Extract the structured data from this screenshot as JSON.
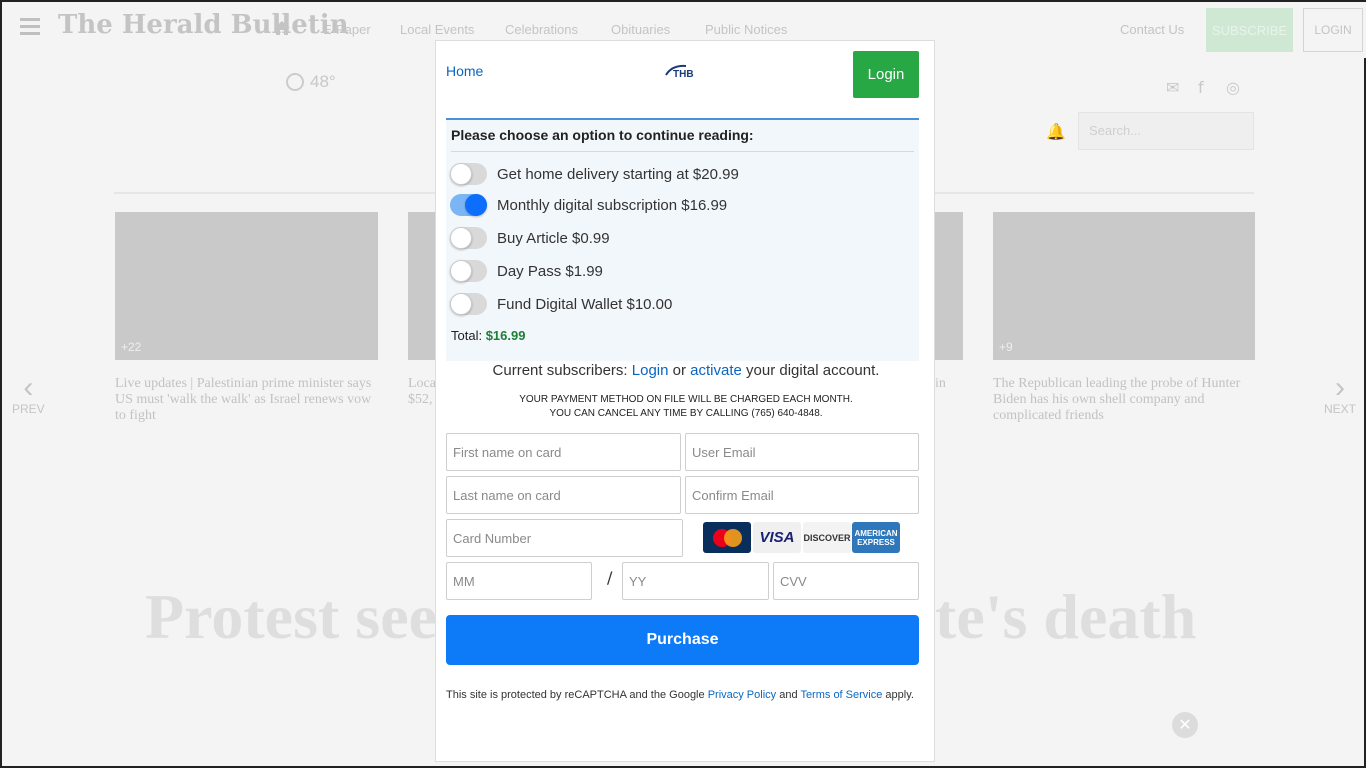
{
  "background": {
    "logo": "The Herald Bulletin",
    "nav": [
      "E-Paper",
      "Local Events",
      "Celebrations",
      "Obituaries",
      "Public Notices"
    ],
    "contact": "Contact Us",
    "subscribe": "SUBSCRIBE",
    "login": "LOGIN",
    "weather": "48°",
    "search_placeholder": "Search...",
    "cards": [
      {
        "count": "+22",
        "caption": "Live updates | Palestinian prime minister says US must 'walk the walk' as Israel renews vow to fight"
      },
      {
        "count": "",
        "caption": "Loca $52,"
      },
      {
        "count": "",
        "caption": "in"
      },
      {
        "count": "+9",
        "caption": "The Republican leading the probe of Hunter Biden has his own shell company and complicated friends"
      }
    ],
    "prev": "PREV",
    "next": "NEXT",
    "headline_left": "Protest see",
    "headline_right": "te's death"
  },
  "modal": {
    "home": "Home",
    "logo_text": "THB",
    "login": "Login",
    "choose_title": "Please choose an option to continue reading:",
    "options": [
      {
        "label": "Get home delivery starting at $20.99",
        "on": false
      },
      {
        "label": "Monthly digital subscription $16.99",
        "on": true
      },
      {
        "label": "Buy Article $0.99",
        "on": false
      },
      {
        "label": "Day Pass $1.99",
        "on": false
      },
      {
        "label": "Fund Digital Wallet $10.00",
        "on": false
      }
    ],
    "total_label": "Total:",
    "total_amount": "$16.99",
    "current_prefix": "Current subscribers:",
    "current_login": "Login",
    "current_or": "or",
    "current_activate": "activate",
    "current_suffix": "your digital account.",
    "notice_line1": "YOUR PAYMENT METHOD ON FILE WILL BE CHARGED EACH MONTH.",
    "notice_line2": "YOU CAN CANCEL ANY TIME BY CALLING (765) 640-4848.",
    "fields": {
      "first_name": "First name on card",
      "user_email": "User Email",
      "last_name": "Last name on card",
      "confirm_email": "Confirm Email",
      "card_number": "Card Number",
      "mm": "MM",
      "slash": "/",
      "yy": "YY",
      "cvv": "CVV"
    },
    "cards": {
      "mastercard": "MasterCard",
      "visa": "VISA",
      "discover": "DISCOVER",
      "amex_line1": "AMERICAN",
      "amex_line2": "EXPRESS"
    },
    "purchase": "Purchase",
    "recaptcha_prefix": "This site is protected by reCAPTCHA and the Google",
    "privacy": "Privacy Policy",
    "and": "and",
    "terms": "Terms of Service",
    "apply": "apply."
  },
  "colors": {
    "primary": "#0d7bf7",
    "login_green": "#28a745",
    "link": "#0a66c2",
    "total_green": "#1e7e34"
  }
}
